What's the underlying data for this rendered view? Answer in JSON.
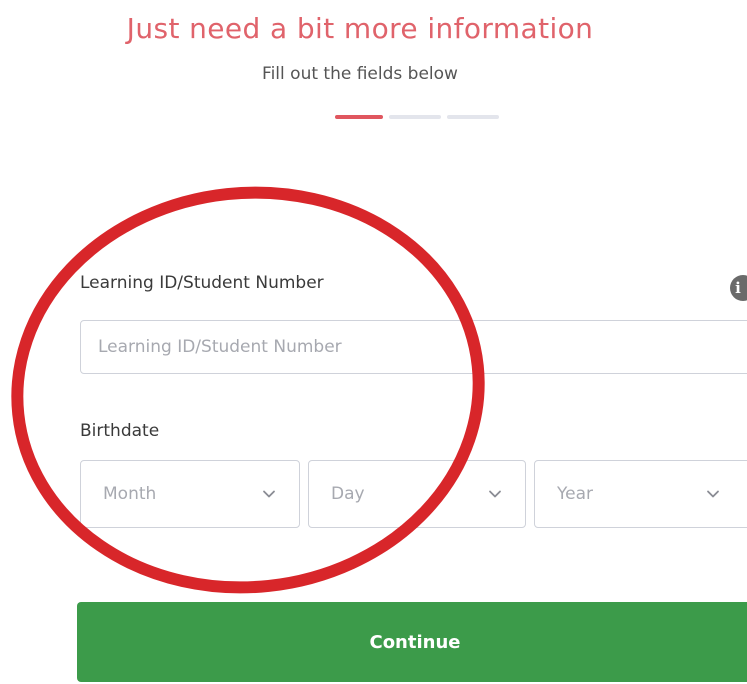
{
  "header": {
    "title": "Just need a bit more information",
    "subtitle": "Fill out the fields below"
  },
  "stepper": {
    "total_steps": 3,
    "current_step": 1
  },
  "form": {
    "student_id": {
      "label": "Learning ID/Student Number",
      "placeholder": "Learning ID/Student Number",
      "value": ""
    },
    "info_icon": "info-icon",
    "birthdate": {
      "label": "Birthdate",
      "month": {
        "selected": "Month"
      },
      "day": {
        "selected": "Day"
      },
      "year": {
        "selected": "Year"
      }
    },
    "continue_label": "Continue"
  },
  "colors": {
    "title": "#e0636b",
    "step_active": "#e0565f",
    "continue_bg": "#3c9b4a",
    "annotation_circle": "#d8262a"
  }
}
